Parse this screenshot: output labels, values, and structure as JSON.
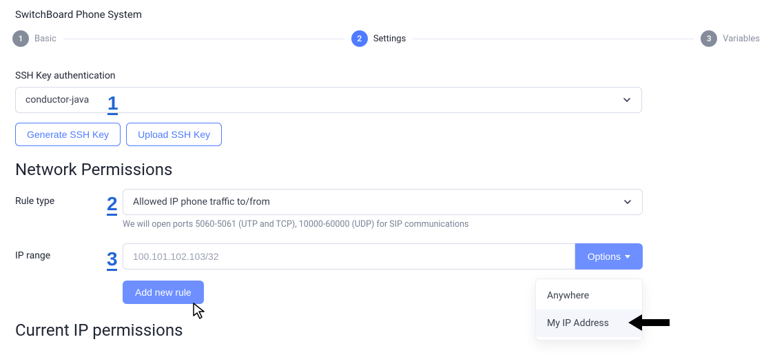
{
  "page": {
    "title": "SwitchBoard Phone System"
  },
  "stepper": {
    "steps": [
      {
        "num": "1",
        "label": "Basic"
      },
      {
        "num": "2",
        "label": "Settings"
      },
      {
        "num": "3",
        "label": "Variables"
      }
    ],
    "current_index": 1
  },
  "ssh": {
    "heading": "SSH Key authentication",
    "selected": "conductor-java",
    "generate_label": "Generate SSH Key",
    "upload_label": "Upload SSH Key"
  },
  "network": {
    "heading": "Network Permissions",
    "rule_type_label": "Rule type",
    "rule_type_value": "Allowed IP phone traffic to/from",
    "rule_type_help": "We will open ports 5060-5061 (UTP and TCP), 10000-60000 (UDP) for SIP communications",
    "ip_range_label": "IP range",
    "ip_range_placeholder": "100.101.102.103/32",
    "ip_range_value": "",
    "options_label": "Options",
    "add_rule_label": "Add new rule",
    "options_menu": {
      "anywhere": "Anywhere",
      "my_ip": "My IP Address"
    }
  },
  "current_heading": "Current IP permissions",
  "annotations": {
    "a1": "1",
    "a2": "2",
    "a3": "3"
  }
}
